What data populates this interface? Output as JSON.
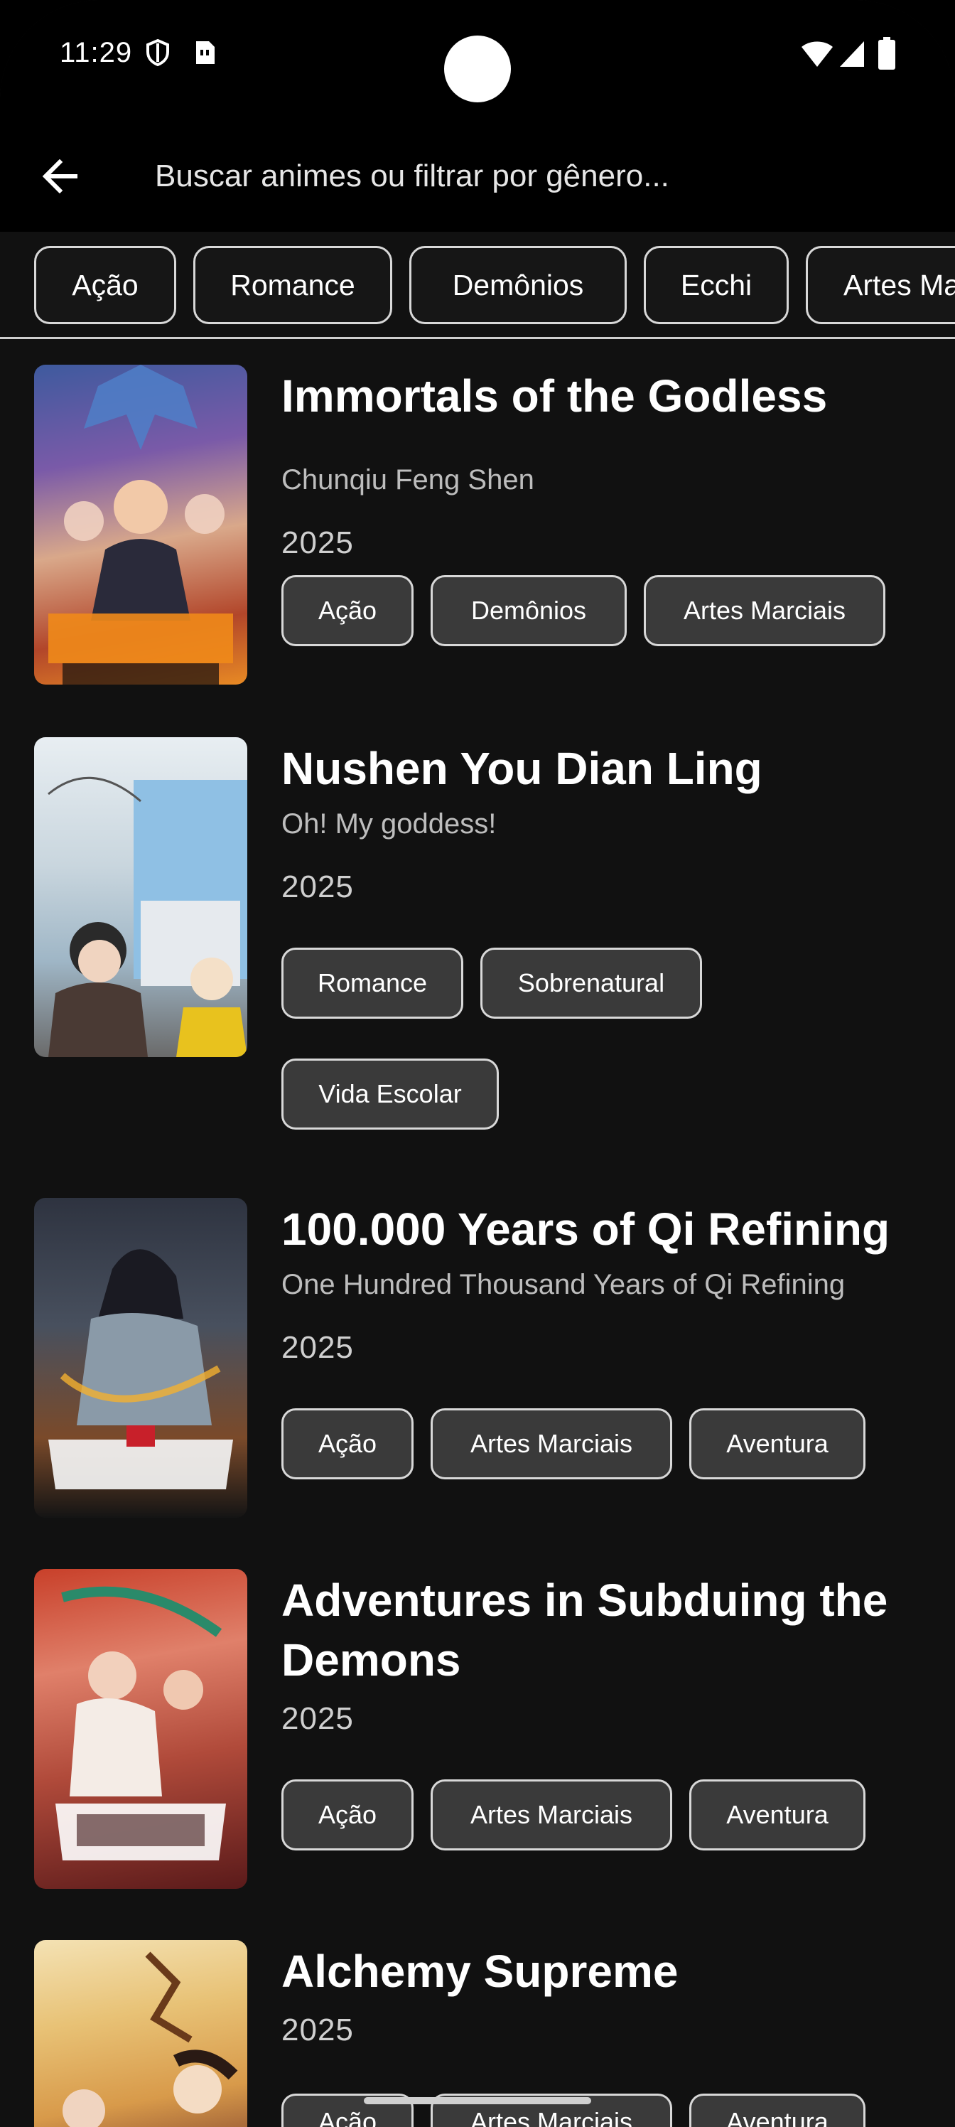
{
  "status": {
    "time": "11:29"
  },
  "search": {
    "placeholder": "Buscar animes ou filtrar por gênero..."
  },
  "genre_chips": [
    "Ação",
    "Romance",
    "Demônios",
    "Ecchi",
    "Artes Marciais"
  ],
  "anime_list": [
    {
      "title": "Immortals of the Godless",
      "subtitle": "Chunqiu Feng Shen",
      "year": "2025",
      "genres": [
        "Ação",
        "Demônios",
        "Artes Marciais"
      ]
    },
    {
      "title": "Nushen You Dian Ling",
      "subtitle": "Oh! My goddess!",
      "year": "2025",
      "genres": [
        "Romance",
        "Sobrenatural",
        "Vida Escolar"
      ]
    },
    {
      "title": "100.000 Years of Qi Refining",
      "subtitle": "One Hundred Thousand Years of Qi Refining",
      "year": "2025",
      "genres": [
        "Ação",
        "Artes Marciais",
        "Aventura"
      ]
    },
    {
      "title": "Adventures in Subduing the Demons",
      "subtitle": "",
      "year": "2025",
      "genres": [
        "Ação",
        "Artes Marciais",
        "Aventura"
      ]
    },
    {
      "title": "Alchemy Supreme",
      "subtitle": "",
      "year": "2025",
      "genres": [
        "Ação",
        "Artes Marciais",
        "Aventura"
      ]
    }
  ],
  "colors": {
    "background": "#111111",
    "bar": "#000000",
    "chip_border": "#d8d8d8",
    "tag_fill": "#3a3a3a"
  }
}
